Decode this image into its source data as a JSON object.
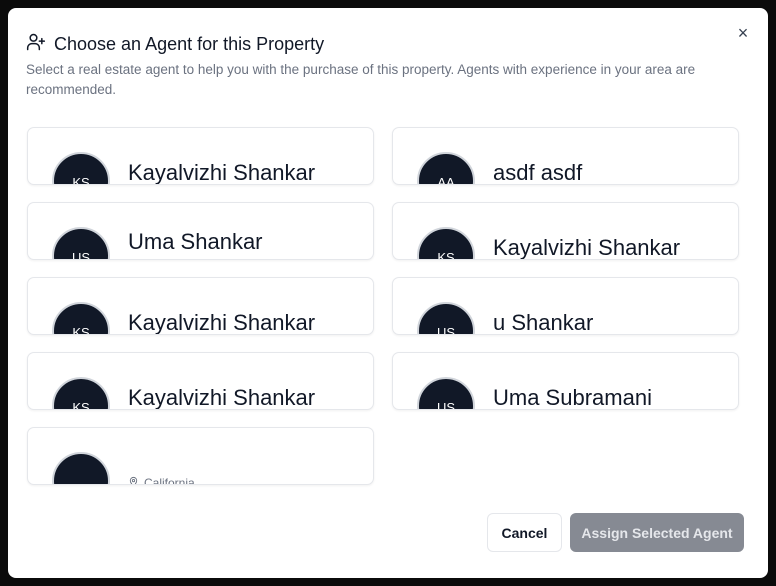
{
  "dialog": {
    "title": "Choose an Agent for this Property",
    "description": "Select a real estate agent to help you with the purchase of this property. Agents with experience in your area are recommended.",
    "close_label": "×"
  },
  "agents": [
    {
      "initials": "KS",
      "name": "Kayalvizhi Shankar"
    },
    {
      "initials": "AA",
      "name": "asdf asdf"
    },
    {
      "initials": "US",
      "name": "Uma Shankar Subramani"
    },
    {
      "initials": "KS",
      "name": "Kayalvizhi Shankar"
    },
    {
      "initials": "KS",
      "name": "Kayalvizhi Shankar"
    },
    {
      "initials": "US",
      "name": "u Shankar"
    },
    {
      "initials": "KS",
      "name": "Kayalvizhi Shankar"
    },
    {
      "initials": "US",
      "name": "Uma Subramani"
    },
    {
      "initials": "",
      "name": "",
      "location": "California"
    }
  ],
  "footer": {
    "cancel_label": "Cancel",
    "assign_label": "Assign Selected Agent"
  },
  "colors": {
    "avatar_bg": "#111827",
    "assign_disabled": "#868a93"
  }
}
